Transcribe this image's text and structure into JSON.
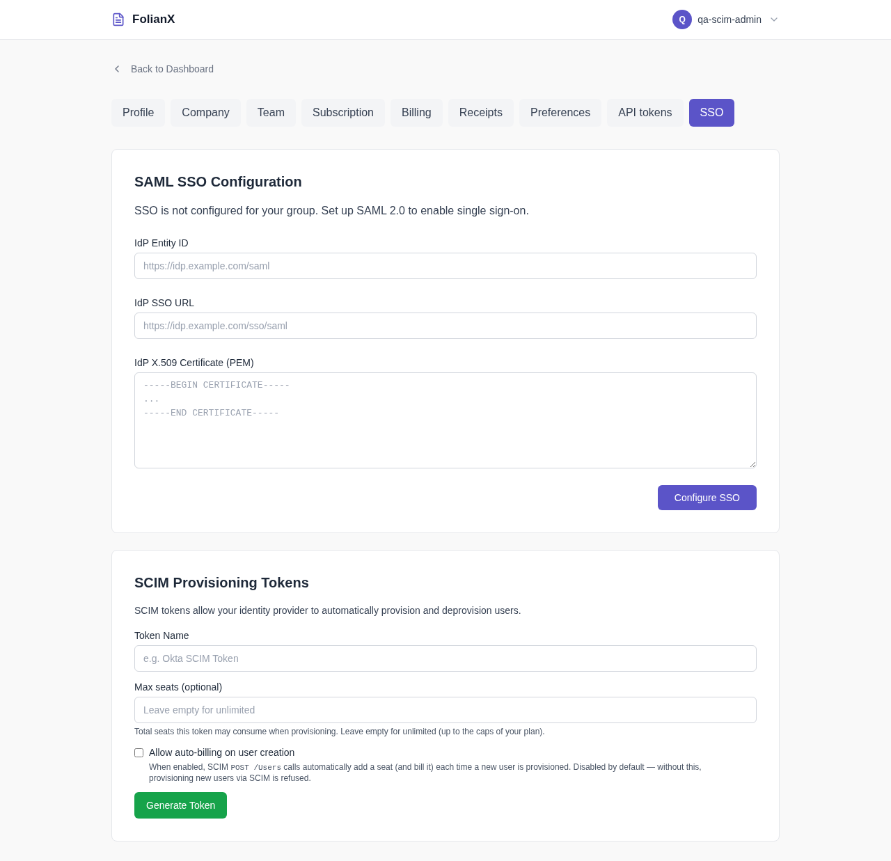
{
  "header": {
    "brand": "FolianX",
    "user": {
      "initial": "Q",
      "name": "qa-scim-admin"
    }
  },
  "back_link": "Back to Dashboard",
  "tabs": [
    {
      "label": "Profile",
      "selected": false
    },
    {
      "label": "Company",
      "selected": false
    },
    {
      "label": "Team",
      "selected": false
    },
    {
      "label": "Subscription",
      "selected": false
    },
    {
      "label": "Billing",
      "selected": false
    },
    {
      "label": "Receipts",
      "selected": false
    },
    {
      "label": "Preferences",
      "selected": false
    },
    {
      "label": "API tokens",
      "selected": false
    },
    {
      "label": "SSO",
      "selected": true
    }
  ],
  "saml": {
    "title": "SAML SSO Configuration",
    "description": "SSO is not configured for your group. Set up SAML 2.0 to enable single sign-on.",
    "fields": [
      {
        "kind": "input",
        "label": "IdP Entity ID",
        "placeholder": "https://idp.example.com/saml"
      },
      {
        "kind": "input",
        "label": "IdP SSO URL",
        "placeholder": "https://idp.example.com/sso/saml"
      },
      {
        "kind": "textarea",
        "label": "IdP X.509 Certificate (PEM)",
        "placeholder": "-----BEGIN CERTIFICATE-----\n...\n-----END CERTIFICATE-----"
      }
    ],
    "button": "Configure SSO"
  },
  "scim": {
    "title": "SCIM Provisioning Tokens",
    "description": "SCIM tokens allow your identity provider to automatically provision and deprovision users.",
    "fields": [
      {
        "label": "Token Name",
        "placeholder": "e.g. Okta SCIM Token"
      },
      {
        "label": "Max seats (optional)",
        "placeholder": "Leave empty for unlimited",
        "hint": "Total seats this token may consume when provisioning. Leave empty for unlimited (up to the caps of your plan)."
      }
    ],
    "auto_billing": {
      "label": "Allow auto-billing on user creation",
      "checked": false,
      "description": [
        {
          "kind": "text",
          "text": "When enabled, SCIM "
        },
        {
          "kind": "code",
          "text": "POST /Users"
        },
        {
          "kind": "text",
          "text": " calls automatically add a seat (and bill it) each time a new user is provisioned. Disabled by default — without this, provisioning new users via SCIM is refused."
        }
      ]
    },
    "button": "Generate Token"
  }
}
